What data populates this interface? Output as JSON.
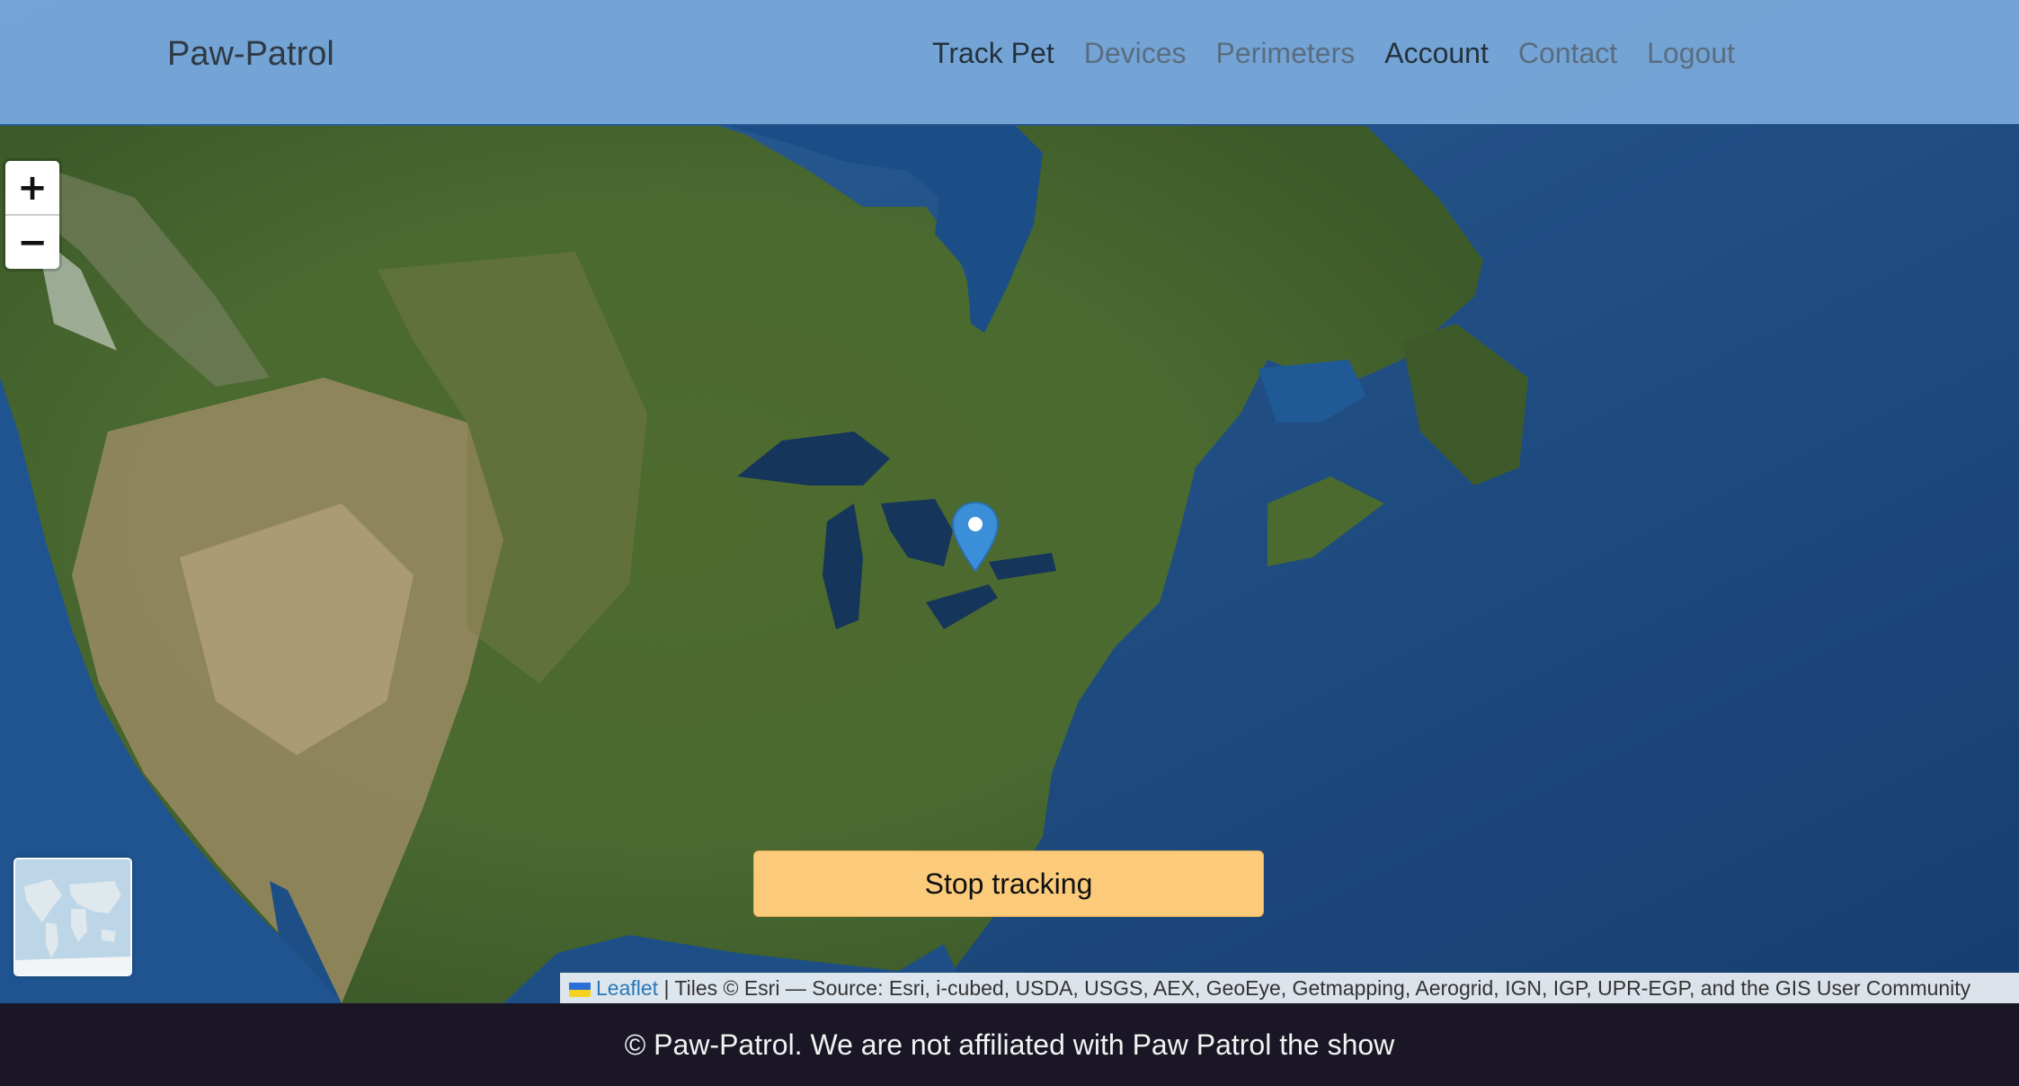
{
  "navbar": {
    "brand": "Paw-Patrol",
    "links": [
      {
        "label": "Track Pet",
        "active": true
      },
      {
        "label": "Devices",
        "active": false
      },
      {
        "label": "Perimeters",
        "active": false
      },
      {
        "label": "Account",
        "active": true
      },
      {
        "label": "Contact",
        "active": false
      },
      {
        "label": "Logout",
        "active": false
      }
    ]
  },
  "map": {
    "zoom_in_label": "+",
    "zoom_out_label": "−",
    "marker_icon": "map-pin-icon",
    "marker_color": "#3b8fd8"
  },
  "stop_button": {
    "label": "Stop tracking",
    "color": "#fbcb7b"
  },
  "attribution": {
    "leaflet_label": "Leaflet",
    "text": "| Tiles © Esri — Source: Esri, i-cubed, USDA, USGS, AEX, GeoEye, Getmapping, Aerogrid, IGN, IGP, UPR-EGP, and the GIS User Community"
  },
  "footer": {
    "text": "© Paw-Patrol. We are not affiliated with Paw Patrol the show"
  }
}
